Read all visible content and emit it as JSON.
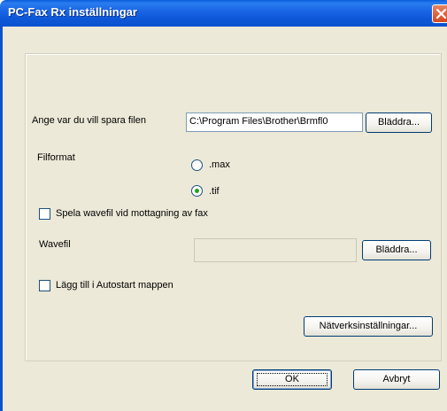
{
  "window": {
    "title": "PC-Fax Rx inställningar"
  },
  "save_location": {
    "label": "Ange var du vill spara filen",
    "path": "C:\\Program Files\\Brother\\Brmfl0",
    "browse_label": "Bläddra..."
  },
  "file_format": {
    "label": "Filformat",
    "options": [
      {
        "label": ".max",
        "selected": false
      },
      {
        "label": ".tif",
        "selected": true
      }
    ]
  },
  "wave_checkbox": {
    "label": "Spela wavefil vid mottagning av fax",
    "checked": false
  },
  "wave_file": {
    "label": "Wavefil",
    "value": "",
    "browse_label": "Bläddra..."
  },
  "autostart_checkbox": {
    "label": "Lägg till i Autostart mappen",
    "checked": false
  },
  "network_button": {
    "label": "Nätverksinställningar..."
  },
  "footer": {
    "ok_label": "OK",
    "cancel_label": "Avbryt"
  },
  "colors": {
    "titlebar": "#0a52cf",
    "dialog_bg": "#ece9d8",
    "close_button": "#d24a20",
    "radio_dot": "#21a121"
  }
}
